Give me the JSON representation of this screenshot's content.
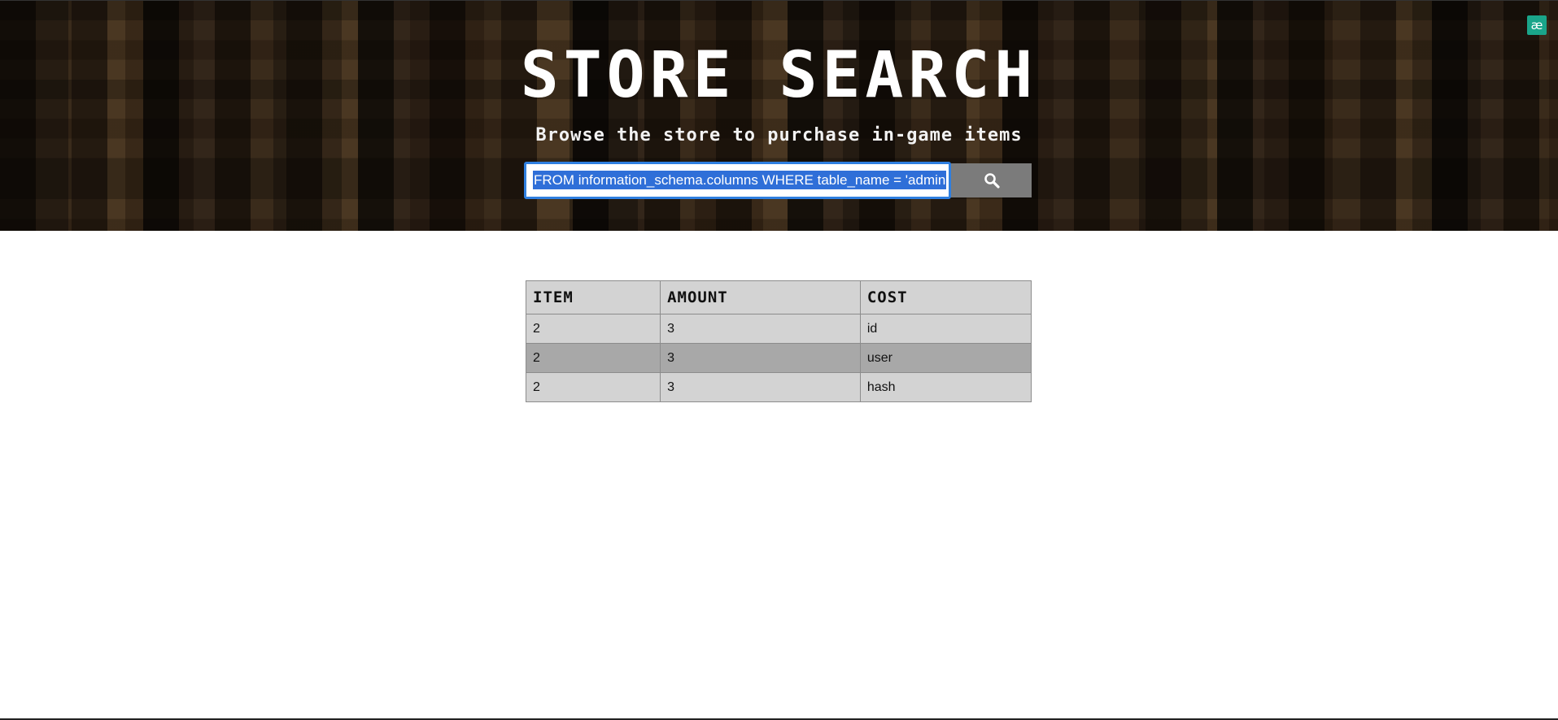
{
  "header": {
    "title": "Store Search",
    "subtitle": "Browse the store to purchase in-game items",
    "corner_badge": "æ"
  },
  "search": {
    "value": "FROM information_schema.columns WHERE table_name = 'admin",
    "button_icon": "search-icon"
  },
  "table": {
    "columns": [
      "Item",
      "Amount",
      "Cost"
    ],
    "rows": [
      [
        "2",
        "3",
        "id"
      ],
      [
        "2",
        "3",
        "user"
      ],
      [
        "2",
        "3",
        "hash"
      ]
    ]
  },
  "colors": {
    "selection": "#2f6fd8",
    "badge": "#1aa58a",
    "button": "#7b7b7b",
    "row": "#d3d3d3",
    "row_alt": "#a8a8a8"
  }
}
